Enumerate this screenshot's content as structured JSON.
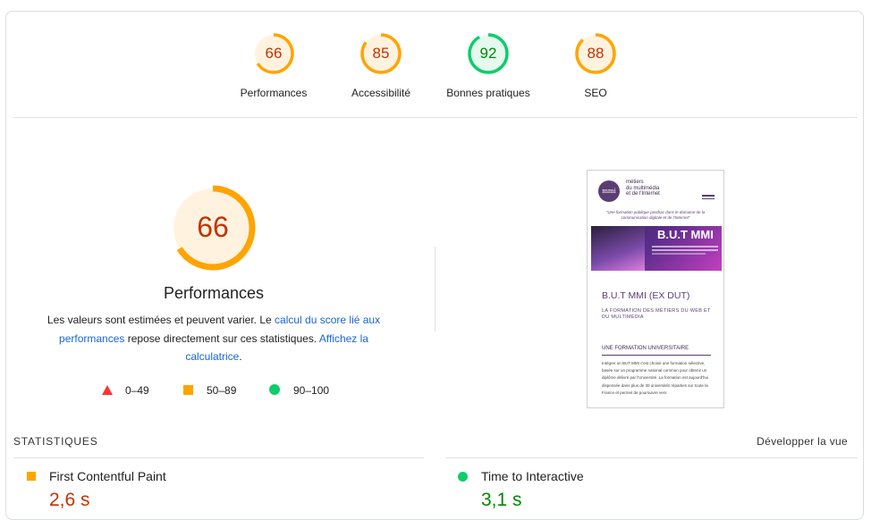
{
  "scores": [
    {
      "label": "Performances",
      "value": "66",
      "status": "average"
    },
    {
      "label": "Accessibilité",
      "value": "85",
      "status": "average"
    },
    {
      "label": "Bonnes pratiques",
      "value": "92",
      "status": "pass"
    },
    {
      "label": "SEO",
      "value": "88",
      "status": "average"
    }
  ],
  "colors": {
    "average": "#ffa400",
    "average_text": "#c33300",
    "average_bg": "#fff3e0",
    "pass": "#0cce6b",
    "pass_text": "#008800",
    "pass_bg": "#e6f9ee",
    "fail": "#ff3333",
    "link": "#1a66d6"
  },
  "main": {
    "score": "66",
    "title": "Performances",
    "desc_1": "Les valeurs sont estimées et peuvent varier. Le ",
    "desc_link_1": "calcul du score lié aux performances",
    "desc_2": " repose directement sur ces statistiques. ",
    "desc_link_2": "Affichez la calculatrice",
    "desc_3": "."
  },
  "legend": [
    {
      "icon": "triangle-icon",
      "range": "0–49"
    },
    {
      "icon": "square-icon",
      "range": "50–89"
    },
    {
      "icon": "circle-icon",
      "range": "90–100"
    }
  ],
  "screenshot": {
    "logo_text": "mmi",
    "site_title_1": "métiers",
    "site_title_2": "du multimédia",
    "site_title_3": "et de l'Internet",
    "quote": "\"Une formation publique postbac dans le domaine de la communication digitale et de l'Internet\"",
    "banner_title": "B.U.T MMI",
    "heading": "B.U.T MMI (EX DUT)",
    "subheading": "LA FORMATION DES MÉTIERS DU WEB ET DU MULTIMÉDIA",
    "section_heading": "UNE FORMATION UNIVERSITAIRE",
    "paragraph": "Intégrer un BUT MMI c'est choisir une formation sélective, basée sur un programme national commun pour obtenir un diplôme délivré par l'Université. La formation est aujourd'hui dispensée dans plus de 30 universités réparties sur toute la France et permet de poursuivre vers"
  },
  "metrics": {
    "section_title": "STATISTIQUES",
    "toggle_label": "Développer la vue",
    "items": [
      {
        "label": "First Contentful Paint",
        "value": "2,6 s",
        "status": "average"
      },
      {
        "label": "Time to Interactive",
        "value": "3,1 s",
        "status": "pass"
      }
    ]
  }
}
